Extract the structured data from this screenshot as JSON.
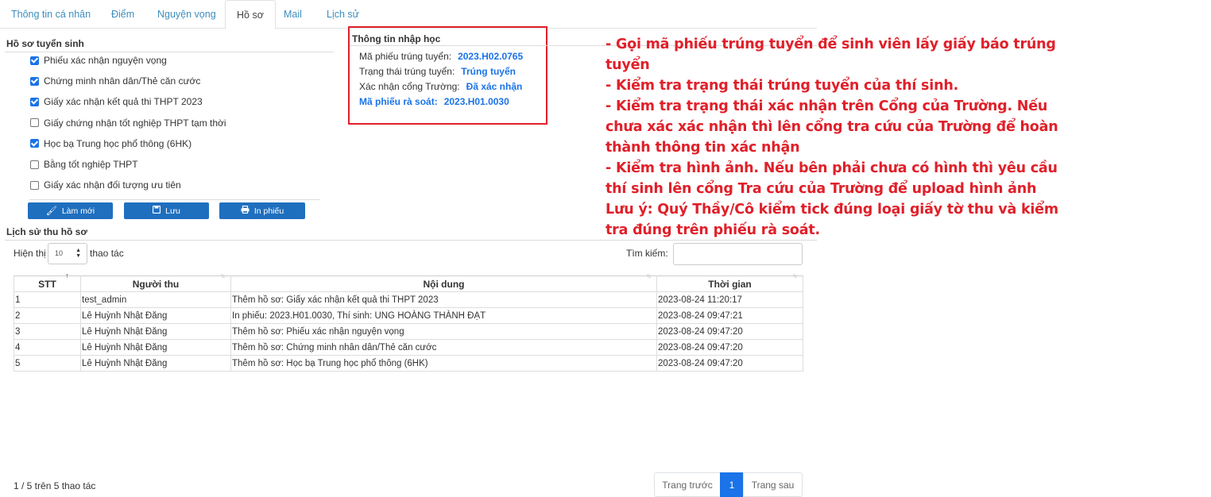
{
  "tabs": [
    {
      "label": "Thông tin cá nhân"
    },
    {
      "label": "Điểm"
    },
    {
      "label": "Nguyện vọng"
    },
    {
      "label": "Hồ sơ"
    },
    {
      "label": "Mail"
    },
    {
      "label": "Lịch sử"
    }
  ],
  "hoso": {
    "title": "Hồ sơ tuyển sinh",
    "items": [
      {
        "label": "Phiếu xác nhận nguyện vọng",
        "checked": true
      },
      {
        "label": "Chứng minh nhân dân/Thẻ căn cước",
        "checked": true
      },
      {
        "label": "Giấy xác nhận kết quả thi THPT 2023",
        "checked": true
      },
      {
        "label": "Giấy chứng nhận tốt nghiệp THPT tạm thời",
        "checked": false
      },
      {
        "label": "Học bạ Trung học phổ thông (6HK)",
        "checked": true
      },
      {
        "label": "Bằng tốt nghiệp THPT",
        "checked": false
      },
      {
        "label": "Giấy xác nhận đối tượng ưu tiên",
        "checked": false
      }
    ],
    "buttons": {
      "refresh": "Làm mới",
      "save": "Lưu",
      "print": "In phiếu"
    }
  },
  "info": {
    "title": "Thông tin nhập học",
    "ma_phieu_label": "Mã phiếu trúng tuyển:",
    "ma_phieu_value": "2023.H02.0765",
    "trang_thai_label": "Trạng thái trúng tuyển:",
    "trang_thai_value": "Trúng tuyển",
    "xac_nhan_label": "Xác nhận cổng Trường:",
    "xac_nhan_value": "Đã xác nhận",
    "ra_soat_label": "Mã phiếu rà soát:",
    "ra_soat_value": "2023.H01.0030"
  },
  "note": [
    "- Gọi mã phiếu trúng tuyển để sinh viên lấy giấy báo trúng tuyển",
    "- Kiểm tra trạng thái trúng tuyển của thí sinh.",
    "- Kiểm tra trạng thái xác nhận trên Cổng của Trường. Nếu chưa xác xác nhận thì lên cổng tra cứu của Trường để hoàn thành thông tin xác nhận",
    "- Kiểm tra hình ảnh. Nếu bên phải chưa có hình thì yêu cầu thí sinh lên cổng Tra cứu của Trường để upload hình ảnh",
    "Lưu ý: Quý Thầy/Cô kiểm tick đúng loại giấy tờ thu và kiểm tra đúng trên phiếu rà soát."
  ],
  "history": {
    "title": "Lịch sử thu hồ sơ",
    "show_label": "Hiện thị",
    "length_value": "10",
    "after_label": "thao tác",
    "search_label": "Tìm kiếm:",
    "search_value": "",
    "columns": [
      "STT",
      "Người thu",
      "Nội dung",
      "Thời gian"
    ],
    "rows": [
      [
        "1",
        "test_admin",
        "Thêm hồ sơ: Giấy xác nhận kết quả thi THPT 2023",
        "2023-08-24 11:20:17"
      ],
      [
        "2",
        "Lê Huỳnh Nhật Đăng",
        "In phiếu: 2023.H01.0030, Thí sinh: UNG HOÀNG THÀNH ĐẠT",
        "2023-08-24 09:47:21"
      ],
      [
        "3",
        "Lê Huỳnh Nhật Đăng",
        "Thêm hồ sơ: Phiếu xác nhận nguyện vọng",
        "2023-08-24 09:47:20"
      ],
      [
        "4",
        "Lê Huỳnh Nhật Đăng",
        "Thêm hồ sơ: Chứng minh nhân dân/Thẻ căn cước",
        "2023-08-24 09:47:20"
      ],
      [
        "5",
        "Lê Huỳnh Nhật Đăng",
        "Thêm hồ sơ: Học bạ Trung học phổ thông (6HK)",
        "2023-08-24 09:47:20"
      ]
    ],
    "footer": "1 / 5 trên 5 thao tác",
    "prev": "Trang trước",
    "page": "1",
    "next": "Trang sau"
  },
  "colors": {
    "accent": "#1a73e8",
    "button": "#1f6fbf",
    "annotation": "#e0202a"
  }
}
